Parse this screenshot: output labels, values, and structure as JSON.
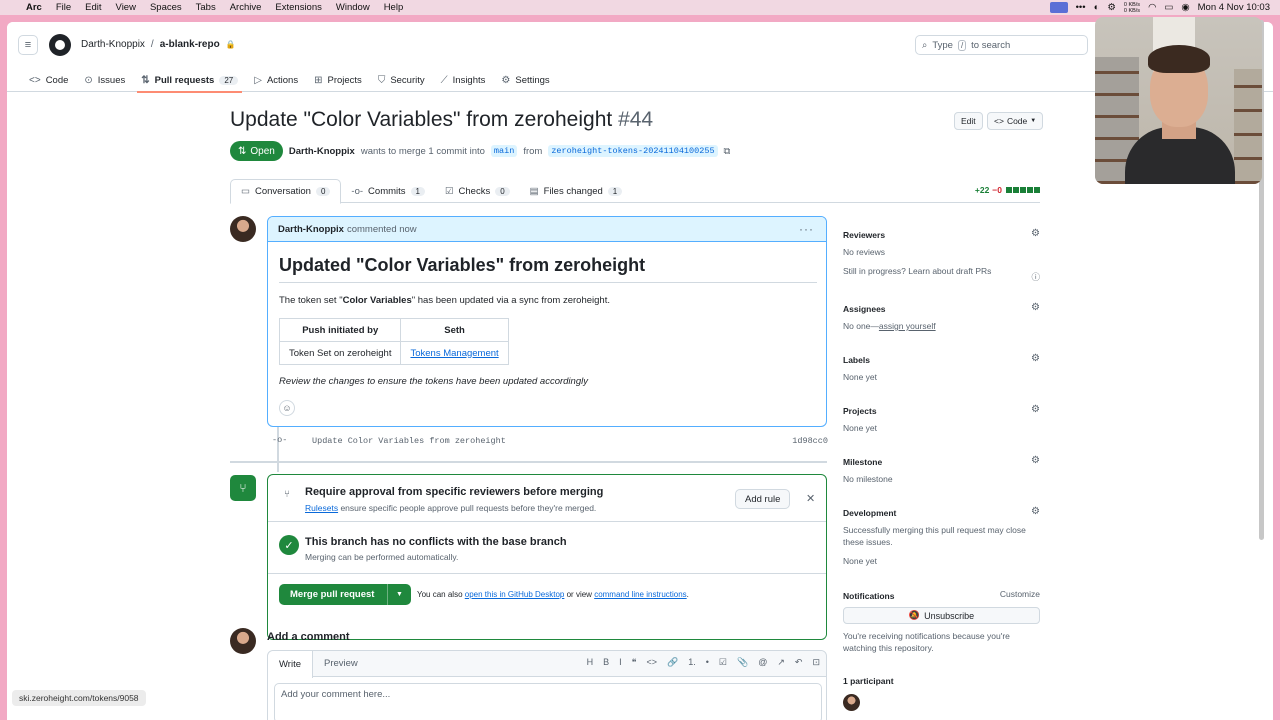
{
  "macos": {
    "apple_glyph": "",
    "app_name": "Arc",
    "menus": [
      "File",
      "Edit",
      "View",
      "Spaces",
      "Tabs",
      "Archive",
      "Extensions",
      "Window",
      "Help"
    ],
    "net_up": "0 KB/s",
    "net_down": "0 KB/s",
    "datetime": "Mon 4 Nov  10:03"
  },
  "header": {
    "owner": "Darth-Knoppix",
    "separator": "/",
    "repo": "a-blank-repo",
    "lock_glyph": "🔒",
    "search_prefix": "Type",
    "search_key": "/",
    "search_suffix": "to search"
  },
  "repo_nav": [
    {
      "icon": "<>",
      "label": "Code",
      "count": null
    },
    {
      "icon": "⊙",
      "label": "Issues",
      "count": null
    },
    {
      "icon": "⇅",
      "label": "Pull requests",
      "count": "27"
    },
    {
      "icon": "▷",
      "label": "Actions",
      "count": null
    },
    {
      "icon": "⊞",
      "label": "Projects",
      "count": null
    },
    {
      "icon": "⛉",
      "label": "Security",
      "count": null
    },
    {
      "icon": "⟋",
      "label": "Insights",
      "count": null
    },
    {
      "icon": "⚙",
      "label": "Settings",
      "count": null
    }
  ],
  "pr": {
    "title": "Update \"Color Variables\" from zeroheight",
    "number": "#44",
    "edit_label": "Edit",
    "code_label": "Code",
    "state": "Open",
    "author": "Darth-Knoppix",
    "merge_text_1": "wants to merge 1 commit into",
    "base_branch": "main",
    "merge_text_2": "from",
    "head_branch": "zeroheight-tokens-20241104100255",
    "tabs": [
      {
        "label": "Conversation",
        "count": "0"
      },
      {
        "label": "Commits",
        "count": "1"
      },
      {
        "label": "Checks",
        "count": "0"
      },
      {
        "label": "Files changed",
        "count": "1"
      }
    ],
    "additions": "+22",
    "deletions": "−0"
  },
  "comment": {
    "author": "Darth-Knoppix",
    "action": "commented now",
    "heading": "Updated \"Color Variables\" from zeroheight",
    "body_pre": "The token set \"",
    "body_bold": "Color Variables",
    "body_post": "\" has been updated via a sync from zeroheight.",
    "table_headers": [
      "Push initiated by",
      "Seth"
    ],
    "table_row": [
      "Token Set on zeroheight",
      "Tokens Management"
    ],
    "note": "Review the changes to ensure the tokens have been updated accordingly"
  },
  "commit": {
    "message": "Update Color Variables from zeroheight",
    "sha": "1d98cc0"
  },
  "merge": {
    "rule_title": "Require approval from specific reviewers before merging",
    "rule_link": "Rulesets",
    "rule_desc": "ensure specific people approve pull requests before they're merged.",
    "add_rule_label": "Add rule",
    "noconflict_title": "This branch has no conflicts with the base branch",
    "noconflict_desc": "Merging can be performed automatically.",
    "merge_button": "Merge pull request",
    "alt_prefix": "You can also",
    "alt_link1": "open this in GitHub Desktop",
    "alt_mid": "or view",
    "alt_link2": "command line instructions",
    "alt_suffix": "."
  },
  "add_comment": {
    "title": "Add a comment",
    "tab_write": "Write",
    "tab_preview": "Preview",
    "toolbar": [
      "H",
      "B",
      "I",
      "❝",
      "<>",
      "🔗",
      "1.",
      "•",
      "☑",
      "📎",
      "@",
      "↗",
      "↶",
      "⊡"
    ],
    "placeholder": "Add your comment here..."
  },
  "sidebar": {
    "reviewers_title": "Reviewers",
    "reviewers_value": "No reviews",
    "draft_q": "Still in progress?",
    "draft_link": "Learn about draft PRs",
    "assignees_title": "Assignees",
    "assignees_none": "No one—",
    "assignees_link": "assign yourself",
    "labels_title": "Labels",
    "labels_value": "None yet",
    "projects_title": "Projects",
    "projects_value": "None yet",
    "milestone_title": "Milestone",
    "milestone_value": "No milestone",
    "development_title": "Development",
    "development_desc": "Successfully merging this pull request may close these issues.",
    "development_value": "None yet",
    "notifications_title": "Notifications",
    "customize_label": "Customize",
    "unsubscribe_label": "Unsubscribe",
    "notif_desc": "You're receiving notifications because you're watching this repository.",
    "participants_title": "1 participant"
  },
  "status_url": "ski.zeroheight.com/tokens/9058",
  "colors": {
    "green": "#1f883d",
    "blue": "#0969da",
    "accent_underline": "#fd8c73"
  }
}
